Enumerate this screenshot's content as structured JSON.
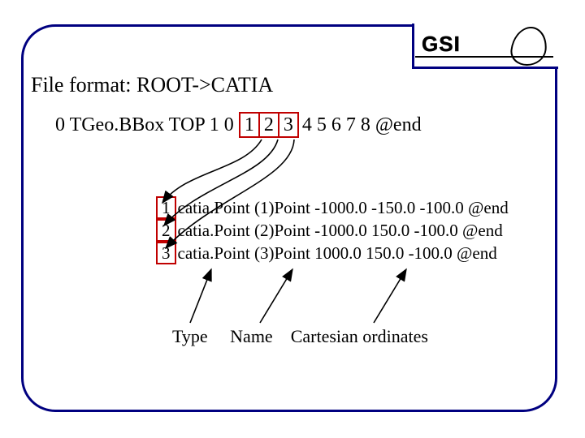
{
  "logo": "GSI",
  "title": "File format: ROOT->CATIA",
  "header": {
    "prefix": "0 TGeo.BBox TOP 1 0 ",
    "boxed": [
      "1",
      "2",
      "3"
    ],
    "suffix": " 4 5 6 7 8 @end"
  },
  "points": [
    {
      "idx": "1",
      "text": "catia.Point (1)Point -1000.0 -150.0 -100.0 @end"
    },
    {
      "idx": "2",
      "text": "catia.Point (2)Point -1000.0 150.0 -100.0 @end"
    },
    {
      "idx": "3",
      "text": "catia.Point (3)Point 1000.0 150.0 -100.0 @end"
    }
  ],
  "labels": {
    "type": "Type",
    "name": "Name",
    "ordinates": "Cartesian ordinates"
  }
}
